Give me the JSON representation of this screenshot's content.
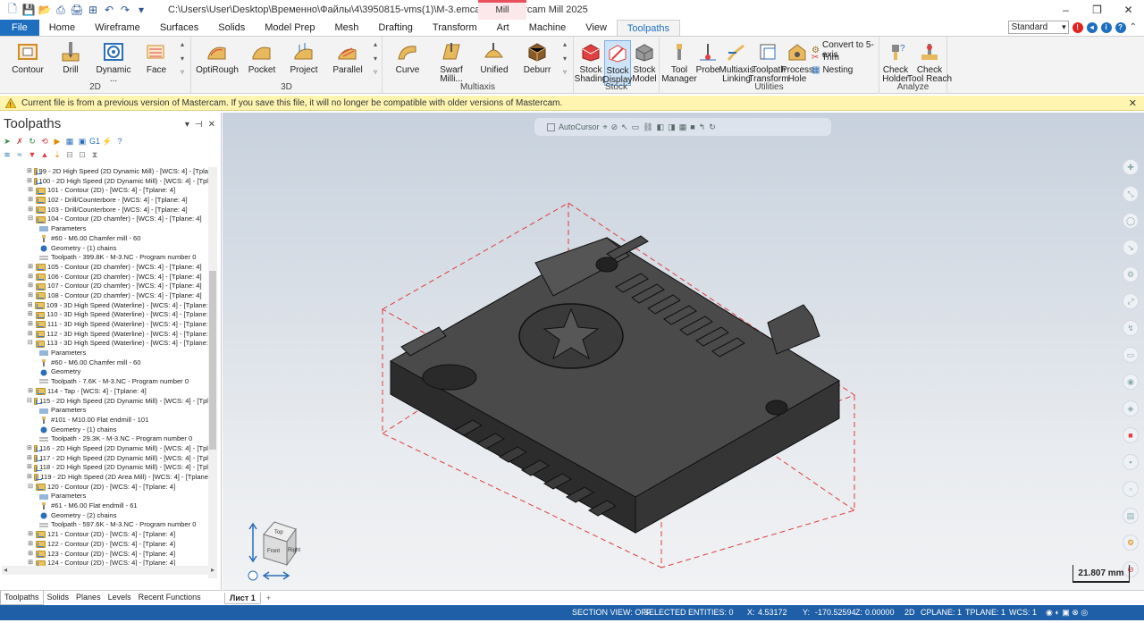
{
  "window": {
    "title": "C:\\Users\\User\\Desktop\\Временно\\Файлы\\4\\3950815-vms(1)\\M-3.emcam - Mastercam Mill 2025",
    "context_tab": "Mill",
    "controls": [
      "–",
      "❐",
      "✕"
    ]
  },
  "tabs": [
    "File",
    "Home",
    "Wireframe",
    "Surfaces",
    "Solids",
    "Model Prep",
    "Mesh",
    "Drafting",
    "Transform",
    "Art",
    "Machine",
    "View",
    "Toolpaths"
  ],
  "active_tab": "Toolpaths",
  "view_select": "Standard",
  "ribbon": {
    "g2d": {
      "label": "2D",
      "buttons": [
        "Contour",
        "Drill",
        "Dynamic ...",
        "Face"
      ]
    },
    "g3d": {
      "label": "3D",
      "buttons": [
        "OptiRough",
        "Pocket",
        "Project",
        "Parallel"
      ]
    },
    "gmulti": {
      "label": "Multiaxis",
      "buttons": [
        "Curve",
        "Swarf Milli...",
        "Unified",
        "Deburr"
      ]
    },
    "gstock": {
      "label": "Stock",
      "buttons": [
        "Stock\nShading",
        "Stock\nDisplay",
        "Stock\nModel"
      ]
    },
    "gutil": {
      "label": "Utilities",
      "buttons": [
        "Tool\nManager",
        "Probe",
        "Multiaxis\nLinking",
        "Toolpath\nTransform",
        "Process\nHole"
      ],
      "small": [
        "Convert to 5-axis",
        "Trim",
        "Nesting"
      ]
    },
    "ganalyze": {
      "label": "Analyze",
      "buttons": [
        "Check\nHolder",
        "Check\nTool Reach"
      ]
    }
  },
  "warning": "Current file is from a previous version of Mastercam. If you save this file, it will no longer be compatible with older versions of Mastercam.",
  "panel": {
    "title": "Toolpaths",
    "tree": [
      {
        "t": "op",
        "text": "99 - 2D High Speed (2D Dynamic Mill) - [WCS: 4] - [Tpla"
      },
      {
        "t": "op",
        "text": "100 - 2D High Speed (2D Dynamic Mill) - [WCS: 4] - [Tpl"
      },
      {
        "t": "op",
        "text": "101 - Contour (2D) - [WCS: 4] - [Tplane: 4]"
      },
      {
        "t": "op",
        "text": "102 - Drill/Counterbore - [WCS: 4] - [Tplane: 4]"
      },
      {
        "t": "op",
        "text": "103 - Drill/Counterbore - [WCS: 4] - [Tplane: 4]"
      },
      {
        "t": "opx",
        "text": "104 - Contour (2D chamfer) - [WCS: 4] - [Tplane: 4]"
      },
      {
        "t": "ch",
        "k": "param",
        "text": "Parameters"
      },
      {
        "t": "ch",
        "k": "tool",
        "text": "#60 - M6.00 Chamfer mill - 60"
      },
      {
        "t": "ch",
        "k": "geo",
        "text": "Geometry - (1) chains"
      },
      {
        "t": "ch",
        "k": "tp",
        "text": "Toolpath - 399.8K - M-3.NC - Program number 0"
      },
      {
        "t": "op",
        "text": "105 - Contour (2D chamfer) - [WCS: 4] - [Tplane: 4]"
      },
      {
        "t": "op",
        "text": "106 - Contour (2D chamfer) - [WCS: 4] - [Tplane: 4]"
      },
      {
        "t": "op",
        "text": "107 - Contour (2D chamfer) - [WCS: 4] - [Tplane: 4]"
      },
      {
        "t": "op",
        "text": "108 - Contour (2D chamfer) - [WCS: 4] - [Tplane: 4]"
      },
      {
        "t": "op",
        "text": "109 - 3D High Speed (Waterline) - [WCS: 4] - [Tplane:"
      },
      {
        "t": "op",
        "text": "110 - 3D High Speed (Waterline) - [WCS: 4] - [Tplane:"
      },
      {
        "t": "op",
        "text": "111 - 3D High Speed (Waterline) - [WCS: 4] - [Tplane:"
      },
      {
        "t": "op",
        "text": "112 - 3D High Speed (Waterline) - [WCS: 4] - [Tplane:"
      },
      {
        "t": "opx",
        "text": "113 - 3D High Speed (Waterline) - [WCS: 4] - [Tplane:"
      },
      {
        "t": "ch",
        "k": "param",
        "text": "Parameters"
      },
      {
        "t": "ch",
        "k": "tool",
        "text": "#60 - M6.00 Chamfer mill - 60"
      },
      {
        "t": "ch",
        "k": "geo",
        "text": "Geometry"
      },
      {
        "t": "ch",
        "k": "tp",
        "text": "Toolpath - 7.6K - M-3.NC - Program number 0"
      },
      {
        "t": "op",
        "text": "114 - Tap - [WCS: 4] - [Tplane: 4]"
      },
      {
        "t": "opx",
        "text": "115 - 2D High Speed (2D Dynamic Mill) - [WCS: 4] - [Tpl"
      },
      {
        "t": "ch",
        "k": "param",
        "text": "Parameters"
      },
      {
        "t": "ch",
        "k": "tool",
        "text": "#101 - M10.00 Flat endmill - 101"
      },
      {
        "t": "ch",
        "k": "geo",
        "text": "Geometry - (1) chains"
      },
      {
        "t": "ch",
        "k": "tp",
        "text": "Toolpath - 29.3K - M-3.NC - Program number 0"
      },
      {
        "t": "op",
        "text": "116 - 2D High Speed (2D Dynamic Mill) - [WCS: 4] - [Tpl"
      },
      {
        "t": "op",
        "text": "117 - 2D High Speed (2D Dynamic Mill) - [WCS: 4] - [Tpl"
      },
      {
        "t": "op",
        "text": "118 - 2D High Speed (2D Dynamic Mill) - [WCS: 4] - [Tpl"
      },
      {
        "t": "op",
        "text": "119 - 2D High Speed (2D Area Mill) - [WCS: 4] - [Tplane"
      },
      {
        "t": "opx",
        "text": "120 - Contour (2D) - [WCS: 4] - [Tplane: 4]"
      },
      {
        "t": "ch",
        "k": "param",
        "text": "Parameters"
      },
      {
        "t": "ch",
        "k": "tool",
        "text": "#61 - M6.00 Flat endmill - 61"
      },
      {
        "t": "ch",
        "k": "geo",
        "text": "Geometry - (2) chains"
      },
      {
        "t": "ch",
        "k": "tp",
        "text": "Toolpath - 597.6K - M-3.NC - Program number 0"
      },
      {
        "t": "op",
        "text": "121 - Contour (2D) - [WCS: 4] - [Tplane: 4]"
      },
      {
        "t": "op",
        "text": "122 - Contour (2D) - [WCS: 4] - [Tplane: 4]"
      },
      {
        "t": "op",
        "text": "123 - Contour (2D) - [WCS: 4] - [Tplane: 4]"
      },
      {
        "t": "op",
        "text": "124 - Contour (2D) - [WCS: 4] - [Tplane: 4]"
      }
    ],
    "bottom_tabs": [
      "Toolpaths",
      "Solids",
      "Planes",
      "Levels",
      "Recent Functions"
    ]
  },
  "viewport": {
    "autocursor": "AutoCursor",
    "scale": "21.807 mm",
    "cube_faces": [
      "Top",
      "Front",
      "Right"
    ]
  },
  "sheet": {
    "name": "Лист 1",
    "add": "+"
  },
  "status": {
    "section_view": "SECTION VIEW: OFF",
    "selected": "SELECTED ENTITIES: 0",
    "x_label": "X:",
    "x": "4.53172",
    "y_label": "Y:",
    "y": "-170.52594",
    "z_label": "Z:",
    "z": "0.00000",
    "mode": "2D",
    "cplane": "CPLANE: 1",
    "tplane": "TPLANE: 1",
    "wcs": "WCS: 1"
  },
  "colors": {
    "accent": "#1e6fc0",
    "status_bar": "#1e5fa8",
    "bbox": "#e23b3b",
    "part": "#3d3d3d",
    "warning_bg": "#fff5b1"
  }
}
